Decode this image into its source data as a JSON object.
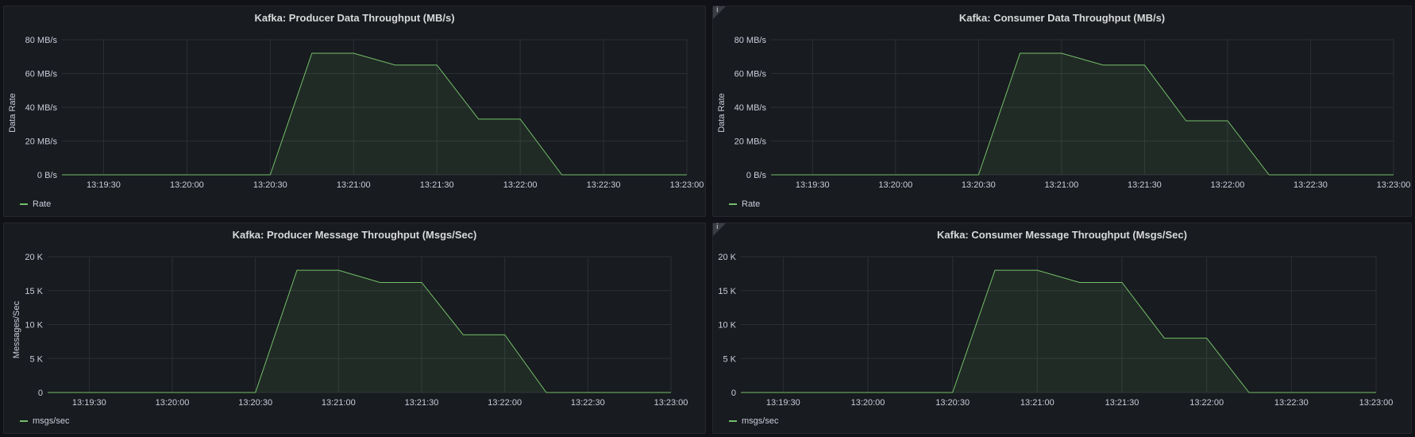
{
  "colors": {
    "series": "#73bf69",
    "grid": "#2c3035",
    "background": "#181b1f"
  },
  "panels": [
    {
      "title": "Kafka: Producer Data Throughput (MB/s)",
      "legend": "Rate",
      "ylabel": "Data Rate",
      "info": false
    },
    {
      "title": "Kafka: Consumer Data Throughput (MB/s)",
      "legend": "Rate",
      "ylabel": "Data Rate",
      "info": true
    },
    {
      "title": "Kafka: Producer Message Throughput (Msgs/Sec)",
      "legend": "msgs/sec",
      "ylabel": "Messages/Sec",
      "info": false
    },
    {
      "title": "Kafka: Consumer Message Throughput (Msgs/Sec)",
      "legend": "msgs/sec",
      "ylabel": "",
      "info": true
    }
  ],
  "chart_data": [
    {
      "type": "area",
      "title": "Kafka: Producer Data Throughput (MB/s)",
      "ylabel": "Data Rate",
      "x": [
        "13:19:15",
        "13:20:30",
        "13:20:45",
        "13:21:00",
        "13:21:15",
        "13:21:30",
        "13:21:45",
        "13:22:00",
        "13:22:15",
        "13:23:00"
      ],
      "series": [
        {
          "name": "Rate",
          "values": [
            0,
            0,
            72,
            72,
            65,
            65,
            33,
            33,
            0,
            0
          ]
        }
      ],
      "xticks": [
        "13:19:30",
        "13:20:00",
        "13:20:30",
        "13:21:00",
        "13:21:30",
        "13:22:00",
        "13:22:30",
        "13:23:00"
      ],
      "yticks": [
        "0 B/s",
        "20 MB/s",
        "40 MB/s",
        "60 MB/s",
        "80 MB/s"
      ],
      "ylim": [
        0,
        80
      ],
      "unit": "MB/s",
      "grid": true,
      "legend": "bottom-left"
    },
    {
      "type": "area",
      "title": "Kafka: Consumer Data Throughput (MB/s)",
      "ylabel": "Data Rate",
      "x": [
        "13:19:15",
        "13:20:30",
        "13:20:45",
        "13:21:00",
        "13:21:15",
        "13:21:30",
        "13:21:45",
        "13:22:00",
        "13:22:15",
        "13:23:00"
      ],
      "series": [
        {
          "name": "Rate",
          "values": [
            0,
            0,
            72,
            72,
            65,
            65,
            32,
            32,
            0,
            0
          ]
        }
      ],
      "xticks": [
        "13:19:30",
        "13:20:00",
        "13:20:30",
        "13:21:00",
        "13:21:30",
        "13:22:00",
        "13:22:30",
        "13:23:00"
      ],
      "yticks": [
        "0 B/s",
        "20 MB/s",
        "40 MB/s",
        "60 MB/s",
        "80 MB/s"
      ],
      "ylim": [
        0,
        80
      ],
      "unit": "MB/s",
      "grid": true,
      "legend": "bottom-left"
    },
    {
      "type": "area",
      "title": "Kafka: Producer Message Throughput (Msgs/Sec)",
      "ylabel": "Messages/Sec",
      "x": [
        "13:19:15",
        "13:20:30",
        "13:20:45",
        "13:21:00",
        "13:21:15",
        "13:21:30",
        "13:21:45",
        "13:22:00",
        "13:22:15",
        "13:23:00"
      ],
      "series": [
        {
          "name": "msgs/sec",
          "values": [
            0,
            0,
            18000,
            18000,
            16200,
            16200,
            8500,
            8500,
            0,
            0
          ]
        }
      ],
      "xticks": [
        "13:19:30",
        "13:20:00",
        "13:20:30",
        "13:21:00",
        "13:21:30",
        "13:22:00",
        "13:22:30",
        "13:23:00"
      ],
      "yticks": [
        "0",
        "5 K",
        "10 K",
        "15 K",
        "20 K"
      ],
      "ylim": [
        0,
        20000
      ],
      "grid": true,
      "legend": "bottom-left"
    },
    {
      "type": "area",
      "title": "Kafka: Consumer Message Throughput (Msgs/Sec)",
      "ylabel": "",
      "x": [
        "13:19:15",
        "13:20:30",
        "13:20:45",
        "13:21:00",
        "13:21:15",
        "13:21:30",
        "13:21:45",
        "13:22:00",
        "13:22:15",
        "13:23:00"
      ],
      "series": [
        {
          "name": "msgs/sec",
          "values": [
            0,
            0,
            18000,
            18000,
            16200,
            16200,
            8000,
            8000,
            0,
            0
          ]
        }
      ],
      "xticks": [
        "13:19:30",
        "13:20:00",
        "13:20:30",
        "13:21:00",
        "13:21:30",
        "13:22:00",
        "13:22:30",
        "13:23:00"
      ],
      "yticks": [
        "0",
        "5 K",
        "10 K",
        "15 K",
        "20 K"
      ],
      "ylim": [
        0,
        20000
      ],
      "grid": true,
      "legend": "bottom-left"
    }
  ]
}
